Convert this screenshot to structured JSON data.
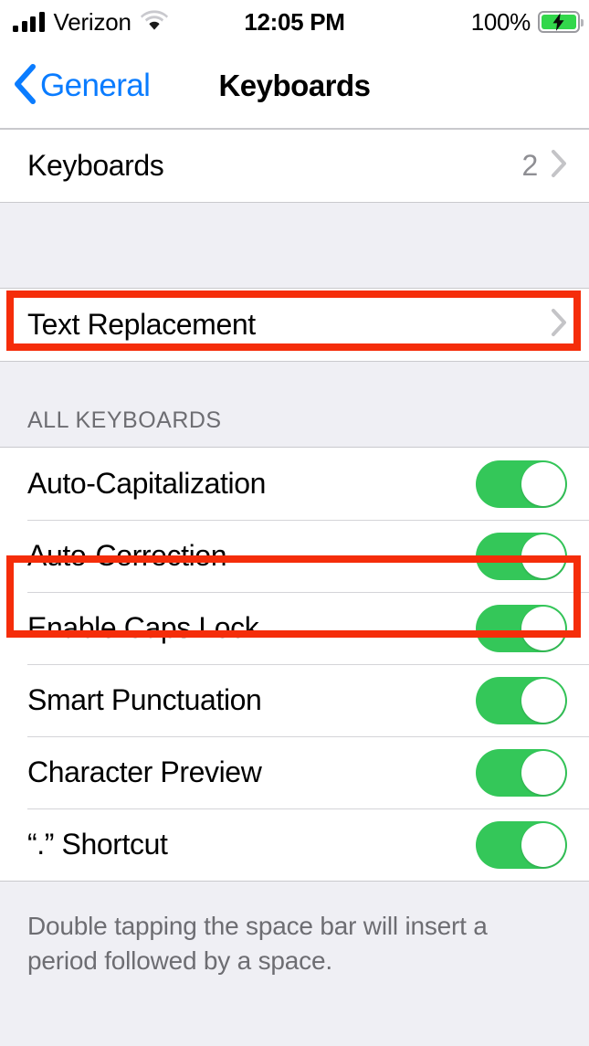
{
  "status_bar": {
    "carrier": "Verizon",
    "signal_icon": "cellular-signal-icon",
    "wifi_icon": "wifi-icon",
    "time": "12:05 PM",
    "battery_percent": "100%",
    "battery_icon": "battery-charging-icon"
  },
  "nav_bar": {
    "back_label": "General",
    "back_icon": "chevron-left-icon",
    "title": "Keyboards",
    "tint_color": "#0a7cff"
  },
  "groups": {
    "keyboards": {
      "rows": [
        {
          "label": "Keyboards",
          "value": "2",
          "accessory": "chevron-right-icon"
        }
      ]
    },
    "text_replacement": {
      "rows": [
        {
          "label": "Text Replacement",
          "value": "",
          "accessory": "chevron-right-icon"
        }
      ]
    },
    "all_keyboards": {
      "header": "ALL KEYBOARDS",
      "rows": [
        {
          "label": "Auto-Capitalization",
          "toggle": "on"
        },
        {
          "label": "Auto-Correction",
          "toggle": "on"
        },
        {
          "label": "Enable Caps Lock",
          "toggle": "on"
        },
        {
          "label": "Smart Punctuation",
          "toggle": "on"
        },
        {
          "label": "Character Preview",
          "toggle": "on"
        },
        {
          "label": "“.” Shortcut",
          "toggle": "on"
        }
      ],
      "footer_line_1": "Double tapping the space bar will insert a",
      "footer_line_2": "period followed by a space."
    }
  },
  "annotations": {
    "color": "#f52d0a",
    "boxes": [
      {
        "name": "text-replacement-highlight",
        "target": "Text Replacement"
      },
      {
        "name": "auto-correction-highlight",
        "target": "Auto-Correction"
      }
    ]
  },
  "colors": {
    "toggle_on": "#34c759",
    "group_background": "#efeff4",
    "row_background": "#ffffff",
    "secondary_text": "#8e8e93"
  }
}
